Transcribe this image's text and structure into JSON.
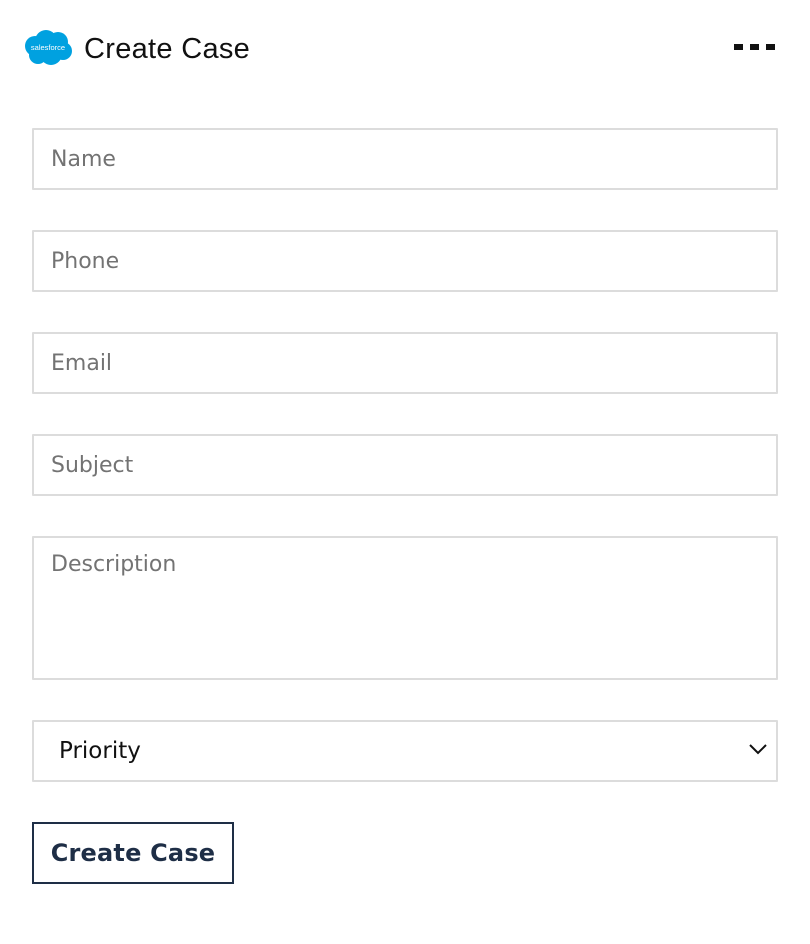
{
  "header": {
    "logo_text": "salesforce",
    "title": "Create Case",
    "menu_icon": "more-horizontal-icon"
  },
  "form": {
    "name_placeholder": "Name",
    "phone_placeholder": "Phone",
    "email_placeholder": "Email",
    "subject_placeholder": "Subject",
    "description_placeholder": "Description",
    "priority": {
      "selected": "Priority",
      "icon": "chevron-down-icon"
    },
    "submit_label": "Create Case"
  },
  "colors": {
    "brand": "#00a1e0",
    "button_text": "#1e2e46",
    "border": "#dcdcdc"
  }
}
